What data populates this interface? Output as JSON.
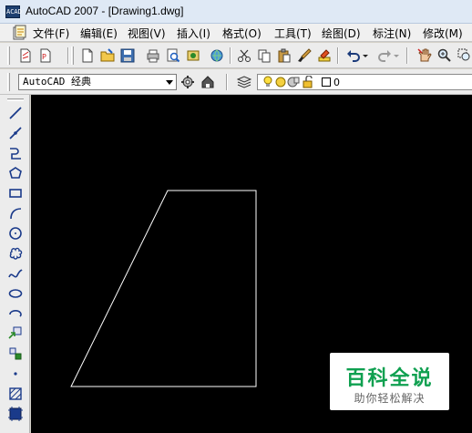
{
  "app": {
    "title": "AutoCAD 2007 - [Drawing1.dwg]",
    "icon_label": "ACAD"
  },
  "menu": [
    {
      "label": "文件(F)",
      "name": "menu-file"
    },
    {
      "label": "编辑(E)",
      "name": "menu-edit"
    },
    {
      "label": "视图(V)",
      "name": "menu-view"
    },
    {
      "label": "插入(I)",
      "name": "menu-insert"
    },
    {
      "label": "格式(O)",
      "name": "menu-format"
    },
    {
      "label": "工具(T)",
      "name": "menu-tools"
    },
    {
      "label": "绘图(D)",
      "name": "menu-draw"
    },
    {
      "label": "标注(N)",
      "name": "menu-dimension"
    },
    {
      "label": "修改(M)",
      "name": "menu-modify"
    }
  ],
  "standard_toolbar": [
    "new-icon",
    "open-icon",
    "save-icon",
    "plot-icon",
    "plot-preview-icon",
    "publish-icon",
    "etransmit-icon",
    "cut-icon",
    "copy-icon",
    "paste-icon",
    "match-properties-icon",
    "brush-icon",
    "undo-icon",
    "redo-icon",
    "pan-icon",
    "zoom-realtime-icon"
  ],
  "workspace": {
    "value": "AutoCAD 经典"
  },
  "layer": {
    "current": "0"
  },
  "draw_toolbar": [
    "line-icon",
    "construction-line-icon",
    "polyline-icon",
    "polygon-icon",
    "rectangle-icon",
    "arc-icon",
    "circle-icon",
    "revision-cloud-icon",
    "spline-icon",
    "ellipse-icon",
    "ellipse-arc-icon",
    "insert-block-icon",
    "make-block-icon",
    "point-icon",
    "hatch-icon",
    "gradient-icon"
  ],
  "watermark": {
    "title": "百科全说",
    "subtitle": "助你轻松解决"
  },
  "colors": {
    "canvas": "#000000",
    "drawing_line": "#ffffff",
    "watermark_accent": "#0fa050"
  }
}
